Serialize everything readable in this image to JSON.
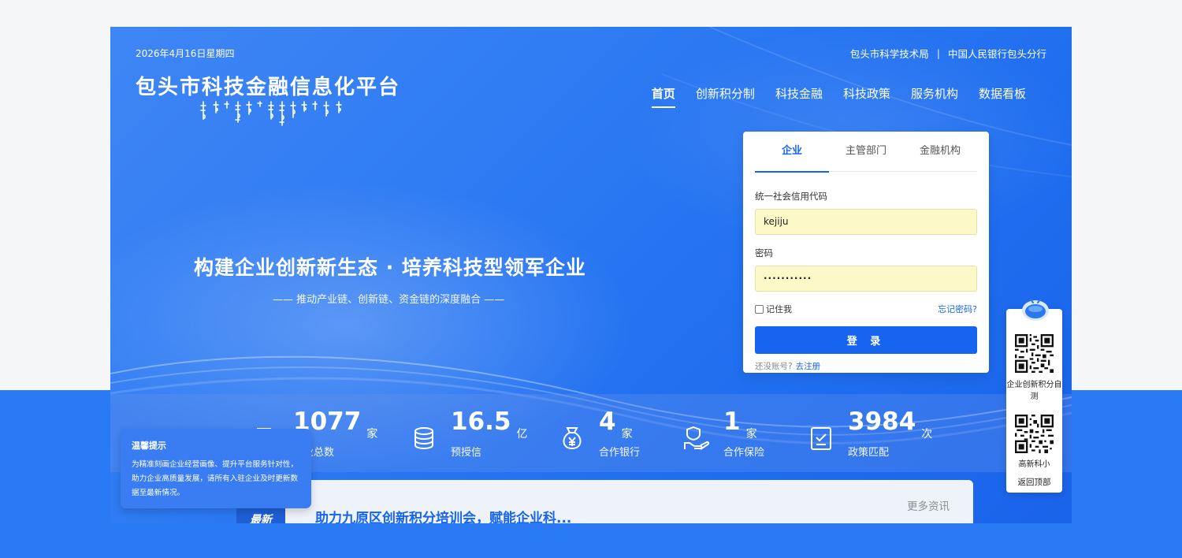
{
  "header": {
    "date": "2026年4月16日星期四",
    "gov_links": [
      "包头市科学技术局",
      "中国人民银行包头分行"
    ],
    "gov_links_separator": "|",
    "site_title": "包头市科技金融信息化平台"
  },
  "nav": {
    "items": [
      "首页",
      "创新积分制",
      "科技金融",
      "科技政策",
      "服务机构",
      "数据看板"
    ],
    "active_index": 0
  },
  "hero": {
    "slogan": "构建企业创新新生态 · 培养科技型领军企业",
    "subslogan": "—— 推动产业链、创新链、资金链的深度融合 ——"
  },
  "login": {
    "tabs": [
      "企业",
      "主管部门",
      "金融机构"
    ],
    "active_tab": 0,
    "username_label": "统一社会信用代码",
    "username_value": "kejiju",
    "password_label": "密码",
    "password_value": "···········",
    "remember_label": "记住我",
    "forgot_label": "忘记密码?",
    "submit_label": "登 录",
    "register_prompt": "还没账号?",
    "register_link": "去注册"
  },
  "stats": [
    {
      "value": "1077",
      "unit": "家",
      "label": "企业总数",
      "icon": "building-icon"
    },
    {
      "value": "16.5",
      "unit": "亿",
      "label": "预授信",
      "icon": "coin-stack-icon"
    },
    {
      "value": "4",
      "unit": "家",
      "label": "合作银行",
      "icon": "money-bag-icon"
    },
    {
      "value": "1",
      "unit": "家",
      "label": "合作保险",
      "icon": "shield-hand-icon"
    },
    {
      "value": "3984",
      "unit": "次",
      "label": "政策匹配",
      "icon": "checklist-icon"
    }
  ],
  "notice": {
    "title": "温馨提示",
    "body": "为精准刻画企业经营画像、提升平台服务针对性，助力企业高质量发展，请所有入驻企业及时更新数据至最新情况。"
  },
  "news": {
    "tag": "最新",
    "title": "助力九原区创新积分培训会，赋能企业科...",
    "more": "更多资讯"
  },
  "sidebar": {
    "qr1_label": "企业创新积分自测",
    "qr2_label": "高新科小",
    "back_to_top": "返回顶部"
  },
  "colors": {
    "primary": "#1664f0",
    "hero_blue": "#2e7bf3",
    "input_autofill": "#fdf8c8"
  }
}
